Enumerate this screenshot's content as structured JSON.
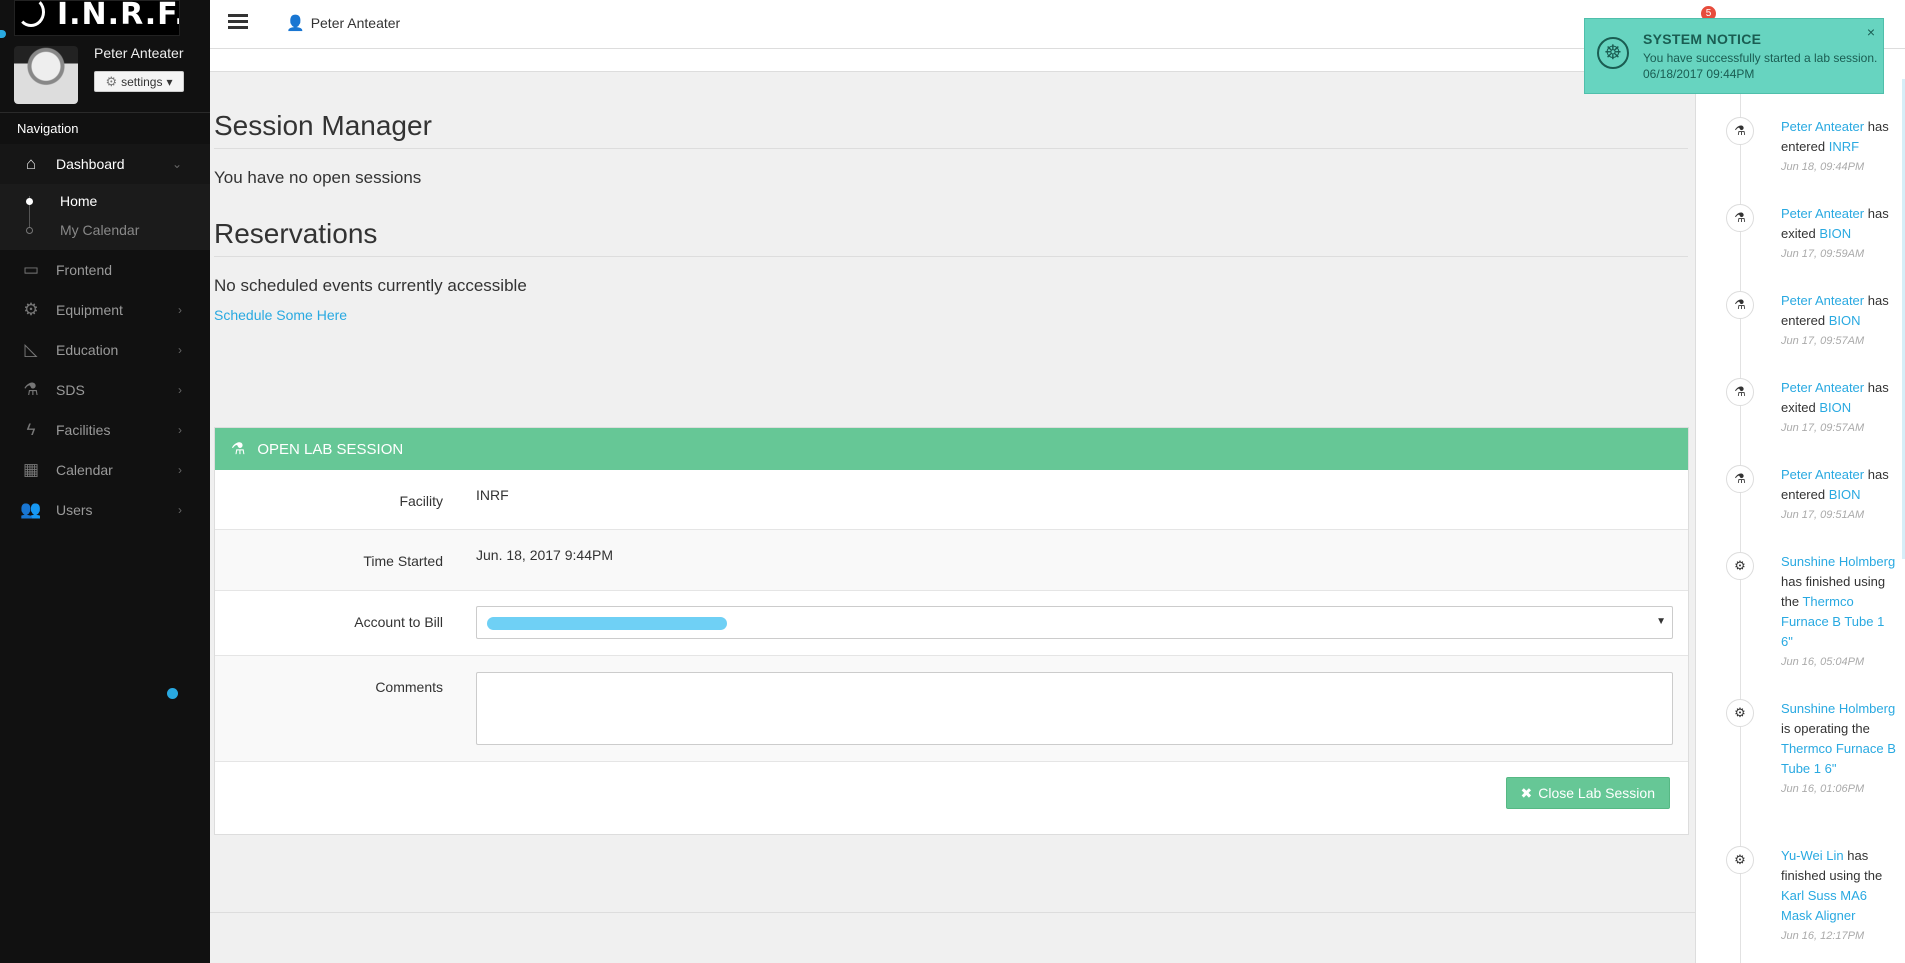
{
  "brand": {
    "logo_text": "I.N.R.F."
  },
  "sidebar": {
    "user_name": "Peter Anteater",
    "settings_label": "settings",
    "nav_heading": "Navigation",
    "items": [
      {
        "label": "Dashboard",
        "icon": "home-icon"
      },
      {
        "label": "Frontend",
        "icon": "laptop-icon"
      },
      {
        "label": "Equipment",
        "icon": "gear-icon"
      },
      {
        "label": "Education",
        "icon": "ruler-icon"
      },
      {
        "label": "SDS",
        "icon": "flask-icon"
      },
      {
        "label": "Facilities",
        "icon": "bolt-icon"
      },
      {
        "label": "Calendar",
        "icon": "calendar-icon"
      },
      {
        "label": "Users",
        "icon": "users-icon"
      }
    ],
    "subitems": [
      {
        "label": "Home"
      },
      {
        "label": "My Calendar"
      }
    ]
  },
  "header": {
    "user_name": "Peter Anteater",
    "notification_count": "5"
  },
  "main": {
    "session_title": "Session Manager",
    "no_sessions": "You have no open sessions",
    "reservations_title": "Reservations",
    "no_events": "No scheduled events currently accessible",
    "schedule_link": "Schedule Some Here"
  },
  "lab_session": {
    "title": "OPEN LAB SESSION",
    "facility_label": "Facility",
    "facility_value": "INRF",
    "time_label": "Time Started",
    "time_value": "Jun. 18, 2017 9:44PM",
    "account_label": "Account to Bill",
    "comments_label": "Comments",
    "close_button": "Close Lab Session"
  },
  "toast": {
    "title": "SYSTEM NOTICE",
    "message": "You have successfully started a lab session.",
    "time": "06/18/2017 09:44PM"
  },
  "feed": [
    {
      "icon": "flask-icon",
      "actor": "Peter Anteater",
      "action": " has entered ",
      "target": "INRF",
      "tail": "",
      "time": "Jun 18, 09:44PM"
    },
    {
      "icon": "flask-icon",
      "actor": "Peter Anteater",
      "action": " has exited ",
      "target": "BION",
      "tail": "",
      "time": "Jun 17, 09:59AM"
    },
    {
      "icon": "flask-icon",
      "actor": "Peter Anteater",
      "action": " has entered ",
      "target": "BION",
      "tail": "",
      "time": "Jun 17, 09:57AM"
    },
    {
      "icon": "flask-icon",
      "actor": "Peter Anteater",
      "action": " has exited ",
      "target": "BION",
      "tail": "",
      "time": "Jun 17, 09:57AM"
    },
    {
      "icon": "flask-icon",
      "actor": "Peter Anteater",
      "action": " has entered ",
      "target": "BION",
      "tail": "",
      "time": "Jun 17, 09:51AM"
    },
    {
      "icon": "gears-icon",
      "actor": "Sunshine Holmberg",
      "action": " has finished using the ",
      "target": "Thermco Furnace B Tube 1 6\"",
      "tail": "",
      "time": "Jun 16, 05:04PM"
    },
    {
      "icon": "gears-icon",
      "actor": "Sunshine Holmberg",
      "action": " is operating the ",
      "target": "Thermco Furnace B Tube 1 6\"",
      "tail": "",
      "time": "Jun 16, 01:06PM"
    },
    {
      "icon": "gears-icon",
      "actor": "Yu-Wei Lin",
      "action": " has finished using the ",
      "target": "Karl Suss MA6 Mask Aligner",
      "tail": "",
      "time": "Jun 16, 12:17PM"
    }
  ]
}
